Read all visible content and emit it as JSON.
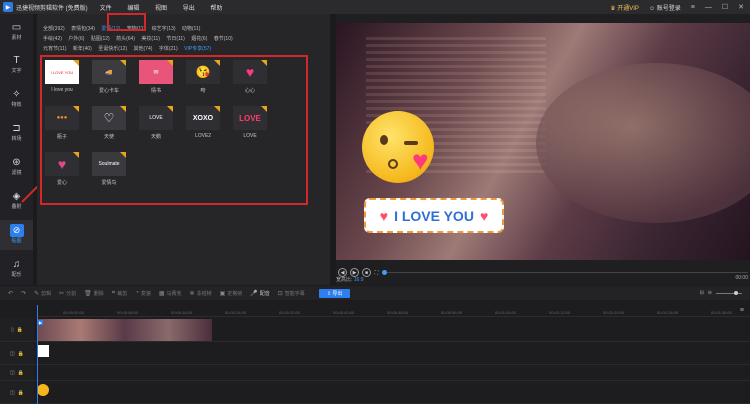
{
  "titlebar": {
    "app_title": "迅捷视频剪辑软件 (免费版)",
    "menu": [
      "文件",
      "编辑",
      "视图",
      "导出",
      "帮助"
    ],
    "vip_label": "开通VIP",
    "account_label": "账号登录"
  },
  "sidebar": {
    "items": [
      {
        "label": "素材",
        "icon": "folder-icon"
      },
      {
        "label": "文字",
        "icon": "text-icon"
      },
      {
        "label": "特效",
        "icon": "effects-icon"
      },
      {
        "label": "转场",
        "icon": "transition-icon"
      },
      {
        "label": "滤镜",
        "icon": "filter-icon"
      },
      {
        "label": "叠附",
        "icon": "layers-icon"
      },
      {
        "label": "贴图",
        "icon": "sticker-icon"
      },
      {
        "label": "配乐",
        "icon": "music-icon"
      }
    ],
    "active_index": 6
  },
  "panel": {
    "tab_rows": [
      [
        "全部(392)",
        "表情包(34)",
        "爱情(12)",
        "宠物(11)",
        "综艺字(13)",
        "动物(11)"
      ],
      [
        "手绘(42)",
        "户外(6)",
        "贴图(12)",
        "箭头(64)",
        "美妆(11)",
        "节日(11)",
        "烟花(6)",
        "春节(10)"
      ],
      [
        "元宵节(11)",
        "新年(40)",
        "圣诞快乐(12)",
        "其他(74)",
        "字体(21)",
        "VIP专享(57)"
      ]
    ],
    "active_tab": "爱情(12)",
    "stickers": [
      {
        "label": "I love you",
        "thumb": "I LOVE YOU"
      },
      {
        "label": "爱心卡车",
        "thumb": "🚚"
      },
      {
        "label": "情书",
        "thumb": "✉"
      },
      {
        "label": "吻",
        "thumb": "😘"
      },
      {
        "label": "心心",
        "thumb": "♥"
      },
      {
        "label": "瓶子",
        "thumb": "●●●"
      },
      {
        "label": "天使",
        "thumb": "♡"
      },
      {
        "label": "天鹅",
        "thumb": "LOVE"
      },
      {
        "label": "LOVE2",
        "thumb": "XOXO"
      },
      {
        "label": "LOVE",
        "thumb": "LOVE"
      },
      {
        "label": "爱心",
        "thumb": "♥"
      },
      {
        "label": "爱情鸟",
        "thumb": "Soulmate"
      }
    ]
  },
  "preview": {
    "sticker_text": "I LOVE YOU",
    "aspect_label": "宽高比:",
    "aspect_value": "16:9",
    "time_right": "00:00"
  },
  "toolbar": {
    "tools": [
      "撤销",
      "重做",
      "剪辑",
      "分割",
      "删除",
      "裁剪",
      "变速",
      "马赛克",
      "冻结帧",
      "定格帧",
      "配音",
      "智能字幕"
    ],
    "export_label": "导出"
  },
  "timeline": {
    "ticks": [
      "00:00:00:00",
      "00:00:08:00",
      "00:00:16:00",
      "00:00:24:00",
      "00:00:32:00",
      "00:00:40:00",
      "00:00:48:00",
      "00:00:56:00",
      "00:01:04:00",
      "00:01:12:00",
      "00:01:20:00",
      "00:01:28:00",
      "00:01:36:00"
    ]
  }
}
